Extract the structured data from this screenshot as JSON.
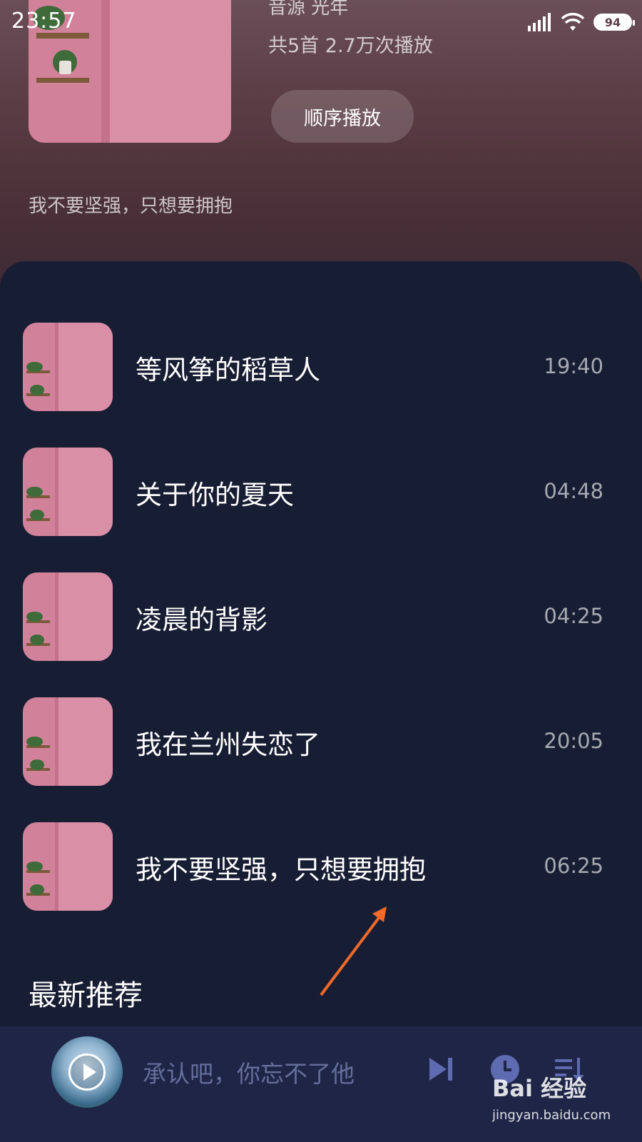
{
  "status_bar": {
    "time": "23:57",
    "battery": "94"
  },
  "playlist": {
    "source": "音源  光年",
    "stats": "共5首  2.7万次播放",
    "play_button_label": "顺序播放",
    "description": "我不要坚强，只想要拥抱"
  },
  "songs": [
    {
      "title": "等风筝的稻草人",
      "duration": "19:40"
    },
    {
      "title": "关于你的夏天",
      "duration": "04:48"
    },
    {
      "title": "凌晨的背影",
      "duration": "04:25"
    },
    {
      "title": "我在兰州失恋了",
      "duration": "20:05"
    },
    {
      "title": "我不要坚强，只想要拥抱",
      "duration": "06:25"
    }
  ],
  "section_title": "最新推荐",
  "player": {
    "current_track": "承认吧，你忘不了他",
    "icons": [
      "play-icon",
      "skip-next-icon",
      "timer-icon",
      "playlist-icon"
    ]
  },
  "watermark": {
    "logo": "Bai 经验",
    "url": "jingyan.baidu.com"
  },
  "colors": {
    "background": "#171d33",
    "header": "#5a3c45",
    "player_bar": "#1e2547",
    "accent_icon": "#5f6bb0",
    "annotation_arrow": "#f06a2a"
  }
}
